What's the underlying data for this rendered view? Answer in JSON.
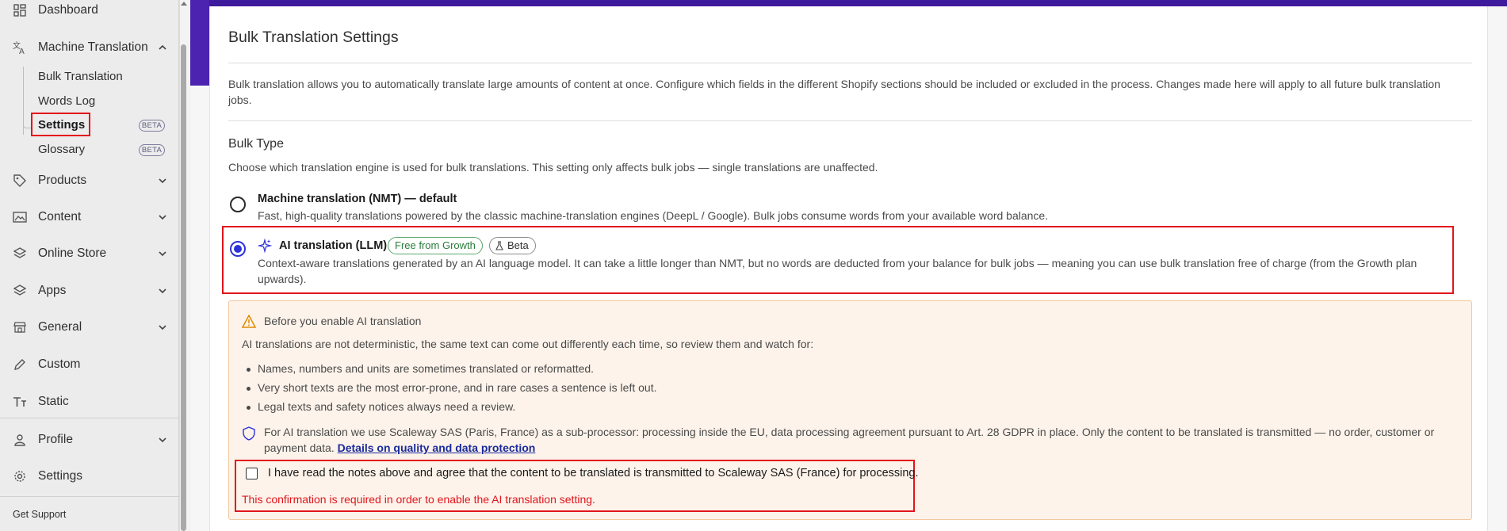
{
  "sidebar": {
    "items": [
      {
        "label": "Dashboard",
        "icon": "dashboard-icon"
      },
      {
        "label": "Machine Translation",
        "icon": "translate-icon",
        "expanded": true
      },
      {
        "label": "Products",
        "icon": "tag-icon"
      },
      {
        "label": "Content",
        "icon": "image-icon"
      },
      {
        "label": "Online Store",
        "icon": "layers-icon"
      },
      {
        "label": "Apps",
        "icon": "apps-icon"
      },
      {
        "label": "General",
        "icon": "store-icon"
      },
      {
        "label": "Custom",
        "icon": "pencil-icon"
      },
      {
        "label": "Static",
        "icon": "text-icon"
      },
      {
        "label": "Profile",
        "icon": "user-icon"
      },
      {
        "label": "Settings",
        "icon": "gear-icon"
      }
    ],
    "subitems": [
      {
        "label": "Bulk Translation"
      },
      {
        "label": "Words Log"
      },
      {
        "label": "Settings",
        "active": true,
        "badge": "BETA"
      },
      {
        "label": "Glossary",
        "badge": "BETA"
      }
    ],
    "support": "Get Support"
  },
  "page": {
    "title": "Bulk Translation Settings",
    "description": "Bulk translation allows you to automatically translate large amounts of content at once. Configure which fields in the different Shopify sections should be included or excluded in the process. Changes made here will apply to all future bulk translation jobs."
  },
  "bulk_type": {
    "title": "Bulk Type",
    "description": "Choose which translation engine is used for bulk translations. This setting only affects bulk jobs — single translations are unaffected.",
    "options": [
      {
        "title": "Machine translation (NMT) — default",
        "description": "Fast, high-quality translations powered by the classic machine-translation engines (DeepL / Google). Bulk jobs consume words from your available word balance.",
        "selected": false
      },
      {
        "title": "AI translation (LLM)",
        "badge_plan": "Free from Growth",
        "badge_beta": "Beta",
        "description": "Context-aware translations generated by an AI language model. It can take a little longer than NMT, but no words are deducted from your balance for bulk jobs — meaning you can use bulk translation free of charge (from the Growth plan upwards).",
        "selected": true
      }
    ]
  },
  "warning": {
    "heading": "Before you enable AI translation",
    "intro": "AI translations are not deterministic, the same text can come out differently each time, so review them and watch for:",
    "bullets": [
      "Names, numbers and units are sometimes translated or reformatted.",
      "Very short texts are the most error-prone, and in rare cases a sentence is left out.",
      "Legal texts and safety notices always need a review."
    ],
    "privacy_text": "For AI translation we use Scaleway SAS (Paris, France) as a sub-processor: processing inside the EU, data processing agreement pursuant to Art. 28 GDPR in place. Only the content to be translated is transmitted — no order, customer or payment data.",
    "privacy_link": "Details on quality and data protection",
    "consent_label": "I have read the notes above and agree that the content to be translated is transmitted to Scaleway SAS (France) for processing.",
    "consent_checked": false,
    "error": "This confirmation is required in order to enable the AI translation setting."
  },
  "colors": {
    "accent": "#2d33d8",
    "brand_purple": "#3e1a9c",
    "error": "#e3141c",
    "warning_bg": "#fdf3ea"
  }
}
